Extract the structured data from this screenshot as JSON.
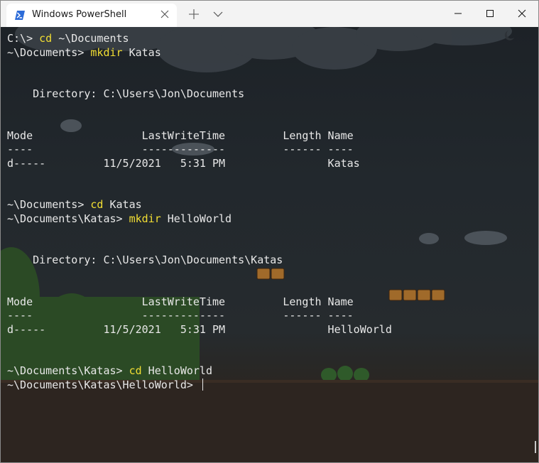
{
  "window": {
    "tab_title": "Windows PowerShell",
    "icons": {
      "tab": "powershell-icon",
      "tab_close": "close-icon",
      "new_tab": "plus-icon",
      "dropdown": "chevron-down-icon",
      "minimize": "minimize-icon",
      "maximize": "maximize-icon",
      "close": "close-icon"
    }
  },
  "terminal": {
    "lines": [
      {
        "prompt": "C:\\> ",
        "cmd": "cd",
        "args": " ~\\Documents"
      },
      {
        "prompt": "~\\Documents> ",
        "cmd": "mkdir",
        "args": " Katas"
      },
      {
        "text": ""
      },
      {
        "text": ""
      },
      {
        "text": "    Directory: C:\\Users\\Jon\\Documents"
      },
      {
        "text": ""
      },
      {
        "text": ""
      },
      {
        "text": "Mode                 LastWriteTime         Length Name"
      },
      {
        "text": "----                 -------------         ------ ----"
      },
      {
        "text": "d-----         11/5/2021   5:31 PM                Katas"
      },
      {
        "text": ""
      },
      {
        "text": ""
      },
      {
        "prompt": "~\\Documents> ",
        "cmd": "cd",
        "args": " Katas"
      },
      {
        "prompt": "~\\Documents\\Katas> ",
        "cmd": "mkdir",
        "args": " HelloWorld"
      },
      {
        "text": ""
      },
      {
        "text": ""
      },
      {
        "text": "    Directory: C:\\Users\\Jon\\Documents\\Katas"
      },
      {
        "text": ""
      },
      {
        "text": ""
      },
      {
        "text": "Mode                 LastWriteTime         Length Name"
      },
      {
        "text": "----                 -------------         ------ ----"
      },
      {
        "text": "d-----         11/5/2021   5:31 PM                HelloWorld"
      },
      {
        "text": ""
      },
      {
        "text": ""
      },
      {
        "prompt": "~\\Documents\\Katas> ",
        "cmd": "cd",
        "args": " HelloWorld"
      },
      {
        "prompt": "~\\Documents\\Katas\\HelloWorld> ",
        "cursor": true
      }
    ],
    "colors": {
      "text": "#e8e8e8",
      "command": "#f2de33"
    }
  }
}
